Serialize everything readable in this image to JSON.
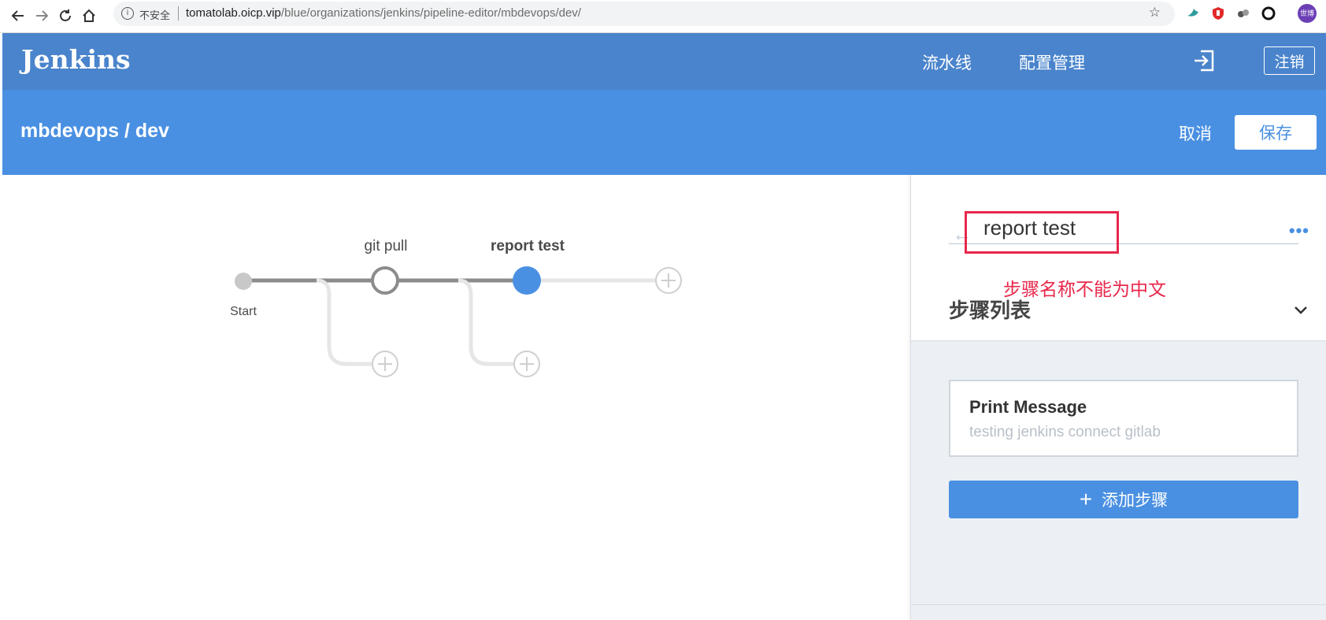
{
  "browser": {
    "security_label": "不安全",
    "url_host": "tomatolab.oicp.vip",
    "url_path": "/blue/organizations/jenkins/pipeline-editor/mbdevops/dev/",
    "info_icon": "info-icon",
    "star_icon": "bookmark-star-icon",
    "extensions": [
      {
        "name": "ext-bird-icon",
        "color": "#2e9b9b"
      },
      {
        "name": "ext-red-shield-icon",
        "color": "#e22a2a"
      },
      {
        "name": "ext-gray-dots-icon",
        "color": "#555555"
      },
      {
        "name": "ext-ring-icon",
        "color": "#111111"
      },
      {
        "name": "profile-avatar-icon",
        "color": "#6b3fb5",
        "text": "世博"
      }
    ]
  },
  "header": {
    "logo": "Jenkins",
    "nav": [
      "流水线",
      "配置管理"
    ],
    "logout_label": "注销",
    "bg_color": "#4a84cc"
  },
  "subheader": {
    "breadcrumb": "mbdevops / dev",
    "cancel_label": "取消",
    "save_label": "保存",
    "bg_color": "#4a90e2"
  },
  "pipeline": {
    "start_label": "Start",
    "stages": [
      {
        "label": "git pull",
        "state": "normal"
      },
      {
        "label": "report test",
        "state": "selected"
      }
    ],
    "accent": "#4a90e2"
  },
  "sheet": {
    "stage_name_value": "report test",
    "annotation": "步骤名称不能为中文",
    "steps_heading": "步骤列表",
    "steps": [
      {
        "title": "Print Message",
        "description": "testing jenkins connect gitlab"
      }
    ],
    "add_step_label": "添加步骤"
  }
}
